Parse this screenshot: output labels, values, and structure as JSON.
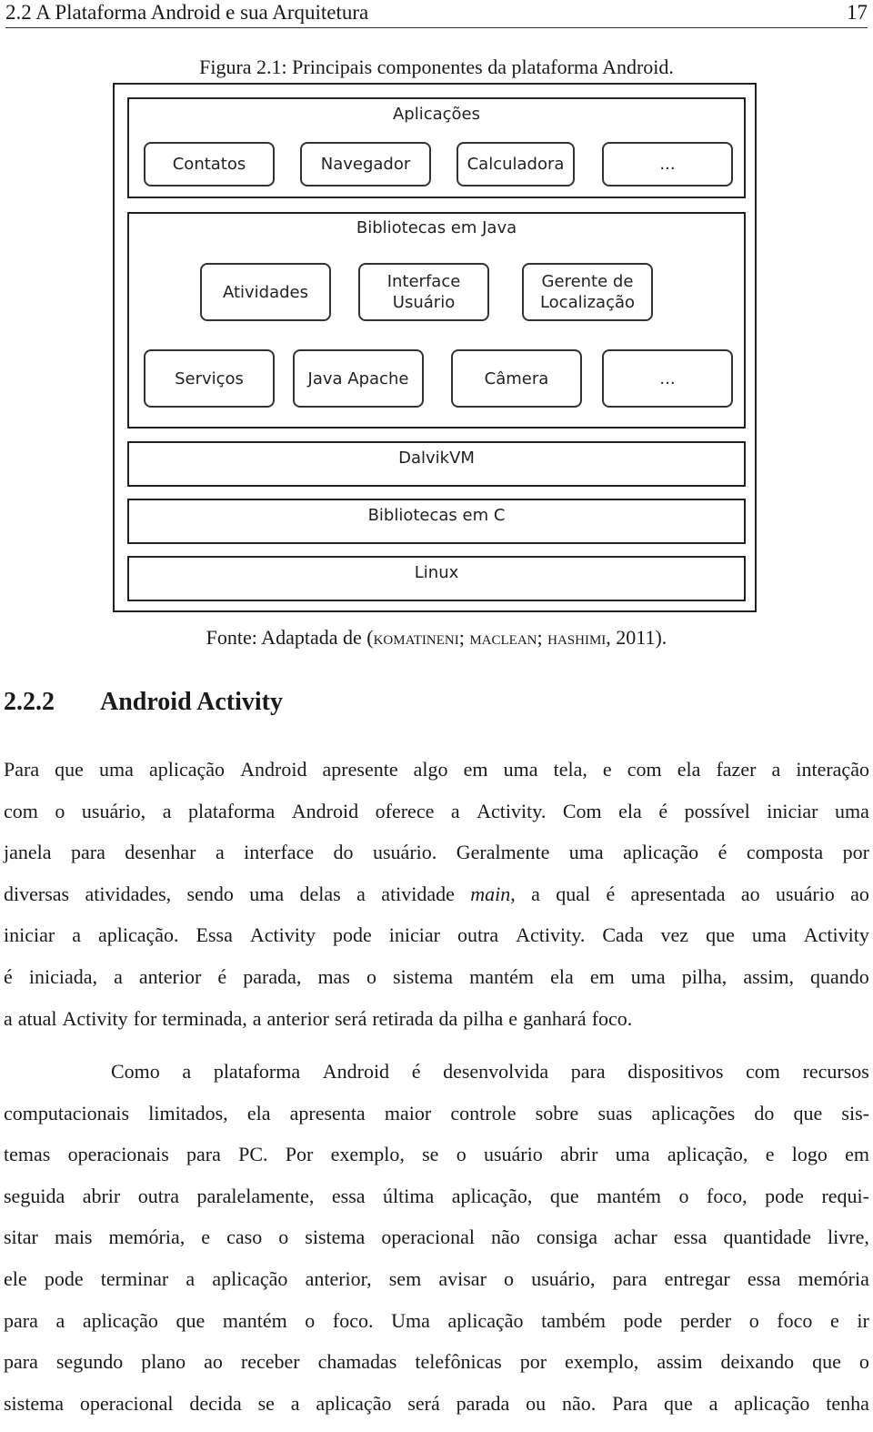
{
  "header": {
    "section_title": "2.2  A Plataforma Android e sua Arquitetura",
    "page_number": "17"
  },
  "figure": {
    "caption": "Figura 2.1: Principais componentes da plataforma Android.",
    "layers": {
      "applications": {
        "title": "Aplicações",
        "items": [
          "Contatos",
          "Navegador",
          "Calculadora",
          "..."
        ]
      },
      "java_libraries": {
        "title": "Bibliotecas em Java",
        "row1": [
          "Atividades",
          "Interface\nUsuário",
          "Gerente de\nLocalização"
        ],
        "row2": [
          "Serviços",
          "Java Apache",
          "Câmera",
          "..."
        ]
      },
      "dalvik": "DalvikVM",
      "c_libraries": "Bibliotecas em C",
      "linux": "Linux"
    },
    "source_prefix": "Fonte: Adaptada de (",
    "source_authors": "komatineni; maclean; hashimi",
    "source_suffix": ", 2011)."
  },
  "section": {
    "number": "2.2.2",
    "title": "Android Activity"
  },
  "paragraphs": [
    {
      "lines": [
        "Para que uma aplicação Android apresente algo em uma tela, e com ela fazer a interação",
        "com o usuário, a plataforma Android oferece a Activity. Com ela é possível iniciar uma",
        "janela para desenhar a interface do usuário. Geralmente uma aplicação é composta por",
        "diversas atividades, sendo uma delas a atividade |main|, a qual é apresentada ao usuário ao",
        "iniciar a aplicação. Essa Activity pode iniciar outra Activity. Cada vez que uma Activity",
        "é iniciada, a anterior é parada, mas o sistema mantém ela em uma pilha, assim, quando",
        "a atual Activity for terminada, a anterior será retirada da pilha e ganhará foco."
      ]
    },
    {
      "lines": [
        "Como a plataforma Android é desenvolvida para dispositivos com recursos",
        "computacionais limitados, ela apresenta maior controle sobre suas aplicações do que sis-",
        "temas operacionais para PC. Por exemplo, se o usuário abrir uma aplicação, e logo em",
        "seguida abrir outra paralelamente, essa última aplicação, que mantém o foco, pode requi-",
        "sitar mais memória, e caso o sistema operacional não consiga achar essa quantidade livre,",
        "ele pode terminar a aplicação anterior, sem avisar o usuário, para entregar essa memória",
        "para a aplicação que mantém o foco. Uma aplicação também pode perder o foco e ir",
        "para segundo plano ao receber chamadas telefônicas por exemplo, assim deixando que o",
        "sistema operacional decida se a aplicação será parada ou não. Para que a aplicação tenha"
      ]
    }
  ]
}
